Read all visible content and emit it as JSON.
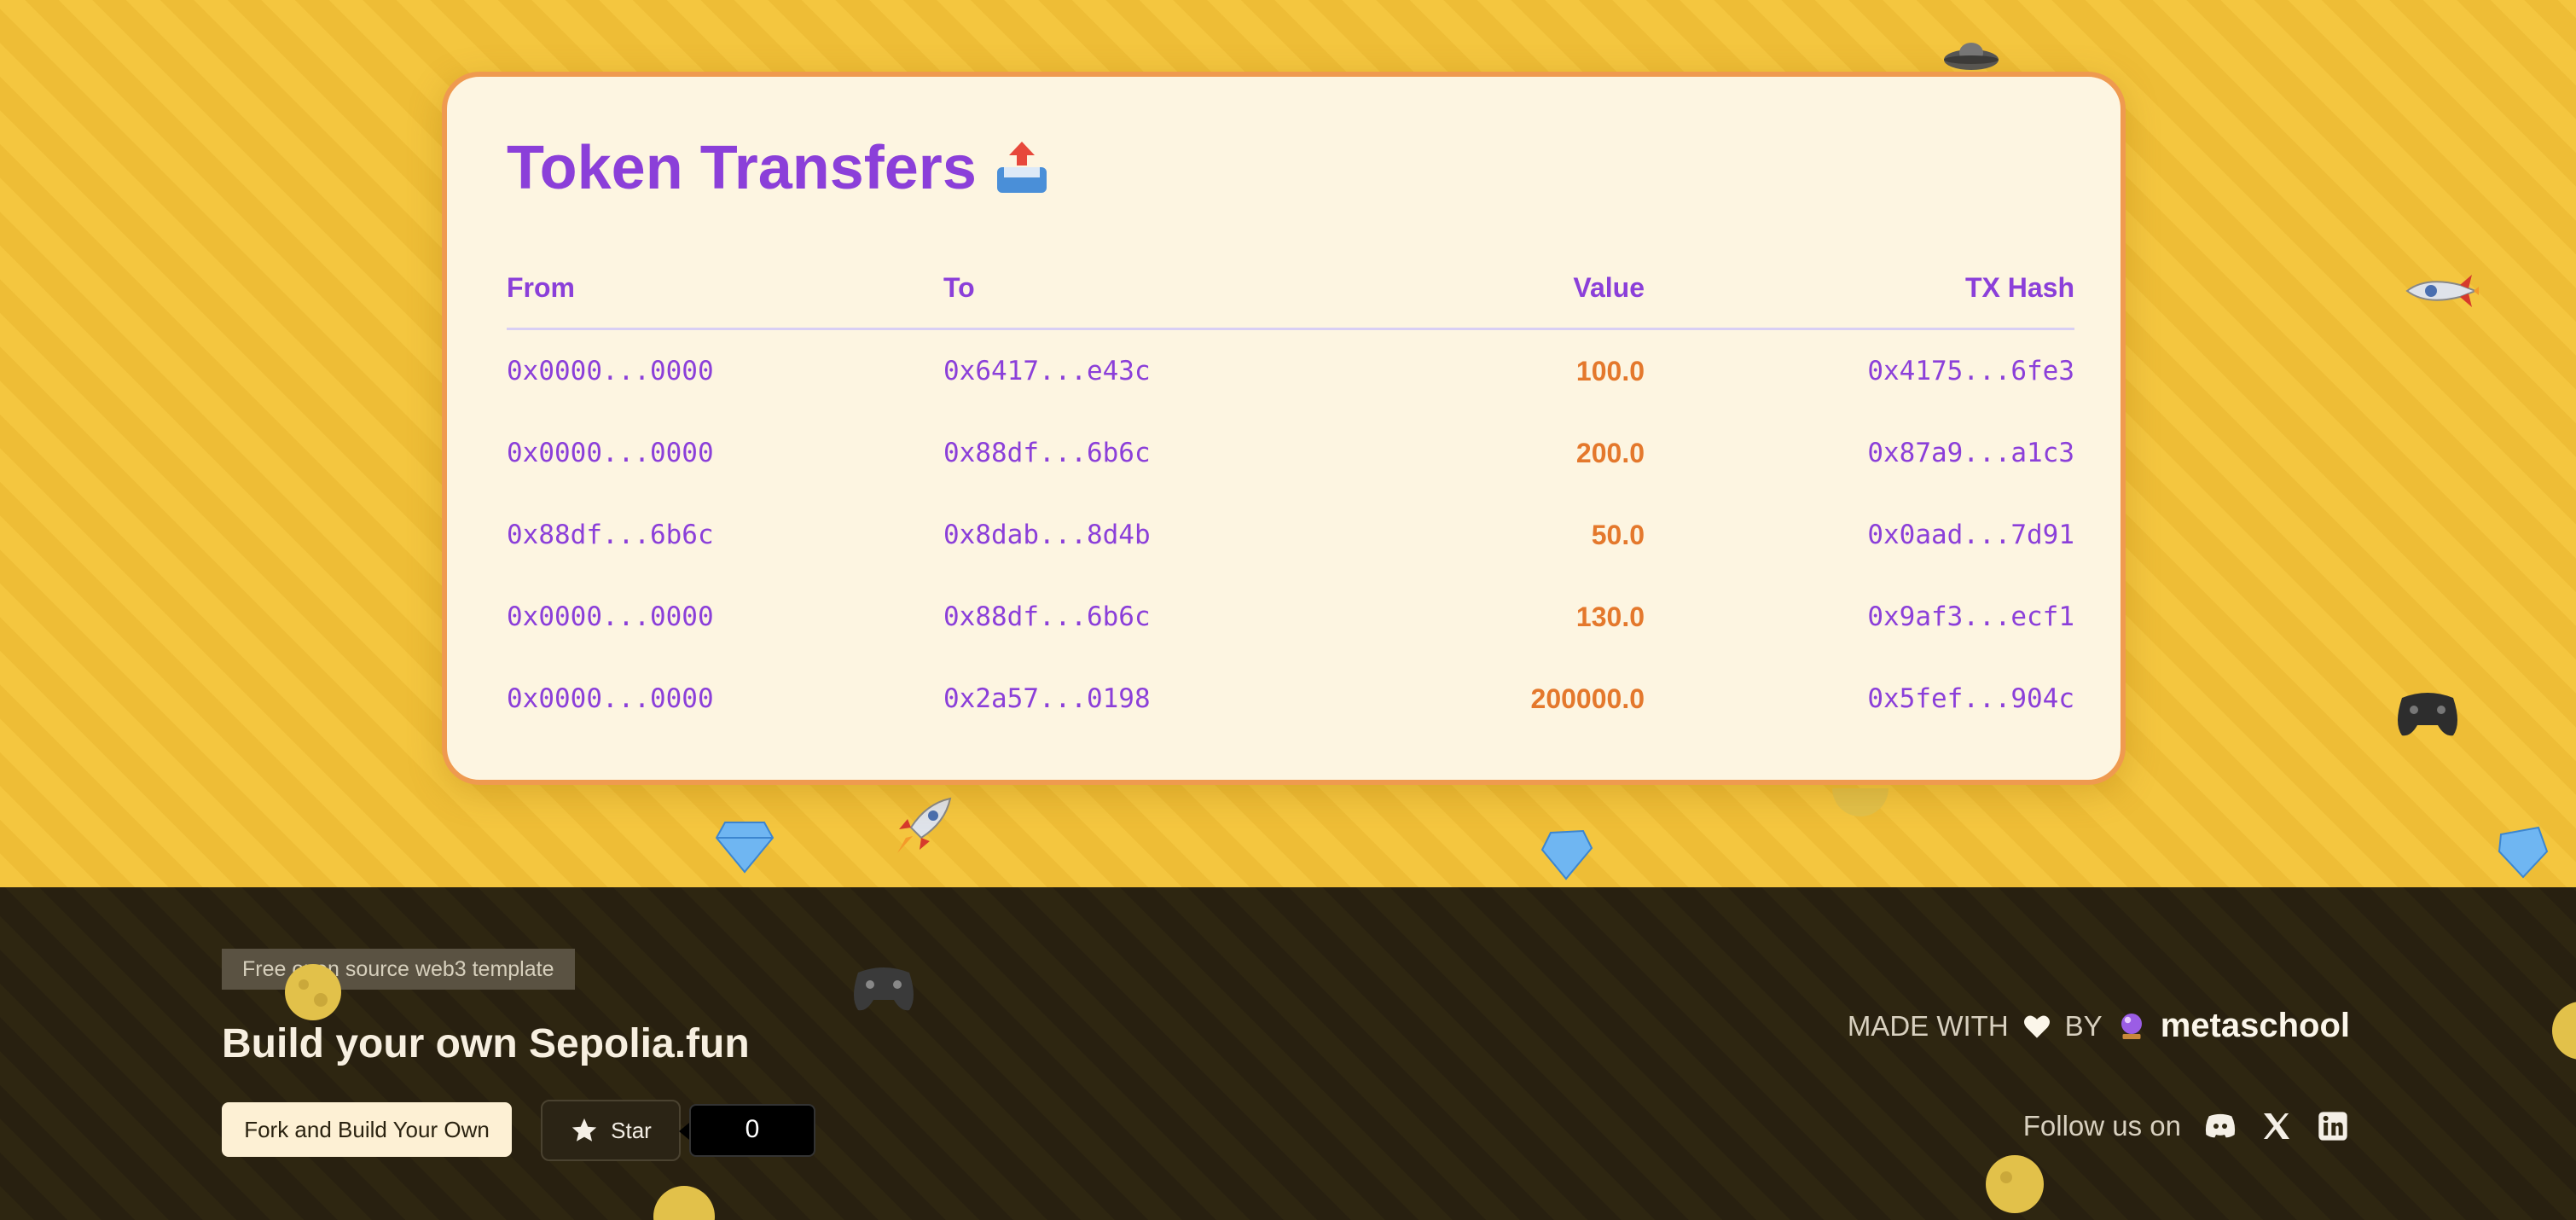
{
  "card": {
    "title": "Token Transfers",
    "title_icon": "outbox-tray-icon",
    "columns": {
      "from": "From",
      "to": "To",
      "value": "Value",
      "tx_hash": "TX Hash"
    },
    "rows": [
      {
        "from": "0x0000...0000",
        "to": "0x6417...e43c",
        "value": "100.0",
        "tx_hash": "0x4175...6fe3"
      },
      {
        "from": "0x0000...0000",
        "to": "0x88df...6b6c",
        "value": "200.0",
        "tx_hash": "0x87a9...a1c3"
      },
      {
        "from": "0x88df...6b6c",
        "to": "0x8dab...8d4b",
        "value": "50.0",
        "tx_hash": "0x0aad...7d91"
      },
      {
        "from": "0x0000...0000",
        "to": "0x88df...6b6c",
        "value": "130.0",
        "tx_hash": "0x9af3...ecf1"
      },
      {
        "from": "0x0000...0000",
        "to": "0x2a57...0198",
        "value": "200000.0",
        "tx_hash": "0x5fef...904c"
      }
    ]
  },
  "footer": {
    "tag": "Free open source web3 template",
    "headline": "Build your own Sepolia.fun",
    "fork_button": "Fork and Build Your Own",
    "star_button": "Star",
    "star_count": "0",
    "made_with": "MADE WITH",
    "by": "BY",
    "brand": "metaschool",
    "follow_label": "Follow us on",
    "social_icons": [
      "discord-icon",
      "x-icon",
      "linkedin-icon"
    ]
  },
  "colors": {
    "accent_purple": "#8b3fd9",
    "value_orange": "#e4782c",
    "card_border": "#ef9a4f",
    "background_yellow": "#f4c63f",
    "footer_dark": "#2e2611"
  },
  "decorations": [
    "rocket-icon",
    "diamond-icon",
    "gamepad-icon",
    "moon-icon",
    "ufo-icon"
  ]
}
